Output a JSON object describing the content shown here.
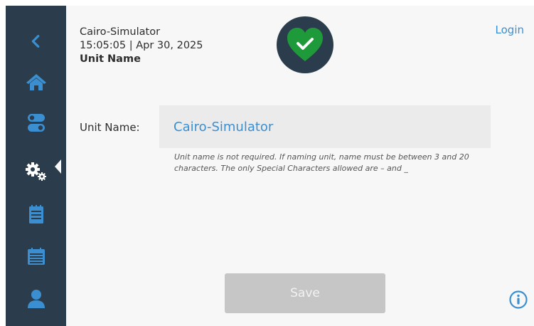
{
  "sidebar": {
    "items": [
      {
        "name": "back",
        "icon": "chevron-left-icon"
      },
      {
        "name": "home",
        "icon": "home-icon"
      },
      {
        "name": "toggles",
        "icon": "toggle-switches-icon"
      },
      {
        "name": "settings",
        "icon": "gears-icon",
        "active": true
      },
      {
        "name": "notes",
        "icon": "notepad-icon"
      },
      {
        "name": "calendar",
        "icon": "calendar-list-icon"
      },
      {
        "name": "user",
        "icon": "user-icon"
      }
    ]
  },
  "header": {
    "device_name": "Cairo-Simulator",
    "datetime": "15:05:05 | Apr 30, 2025",
    "section_title": "Unit Name",
    "status_icon": "heart-check-icon",
    "login_label": "Login"
  },
  "form": {
    "unit_name_label": "Unit Name:",
    "unit_name_value": "Cairo-Simulator",
    "helper_text": "Unit name is not required. If naming unit, name must be between 3 and 20 characters. The only Special Characters allowed are – and _"
  },
  "actions": {
    "save_label": "Save",
    "info_icon": "info-icon"
  },
  "colors": {
    "sidebar": "#2b3d4c",
    "accent_blue": "#3b8fd1",
    "status_green": "#1f9a3a",
    "button_disabled": "#c6c6c6"
  }
}
